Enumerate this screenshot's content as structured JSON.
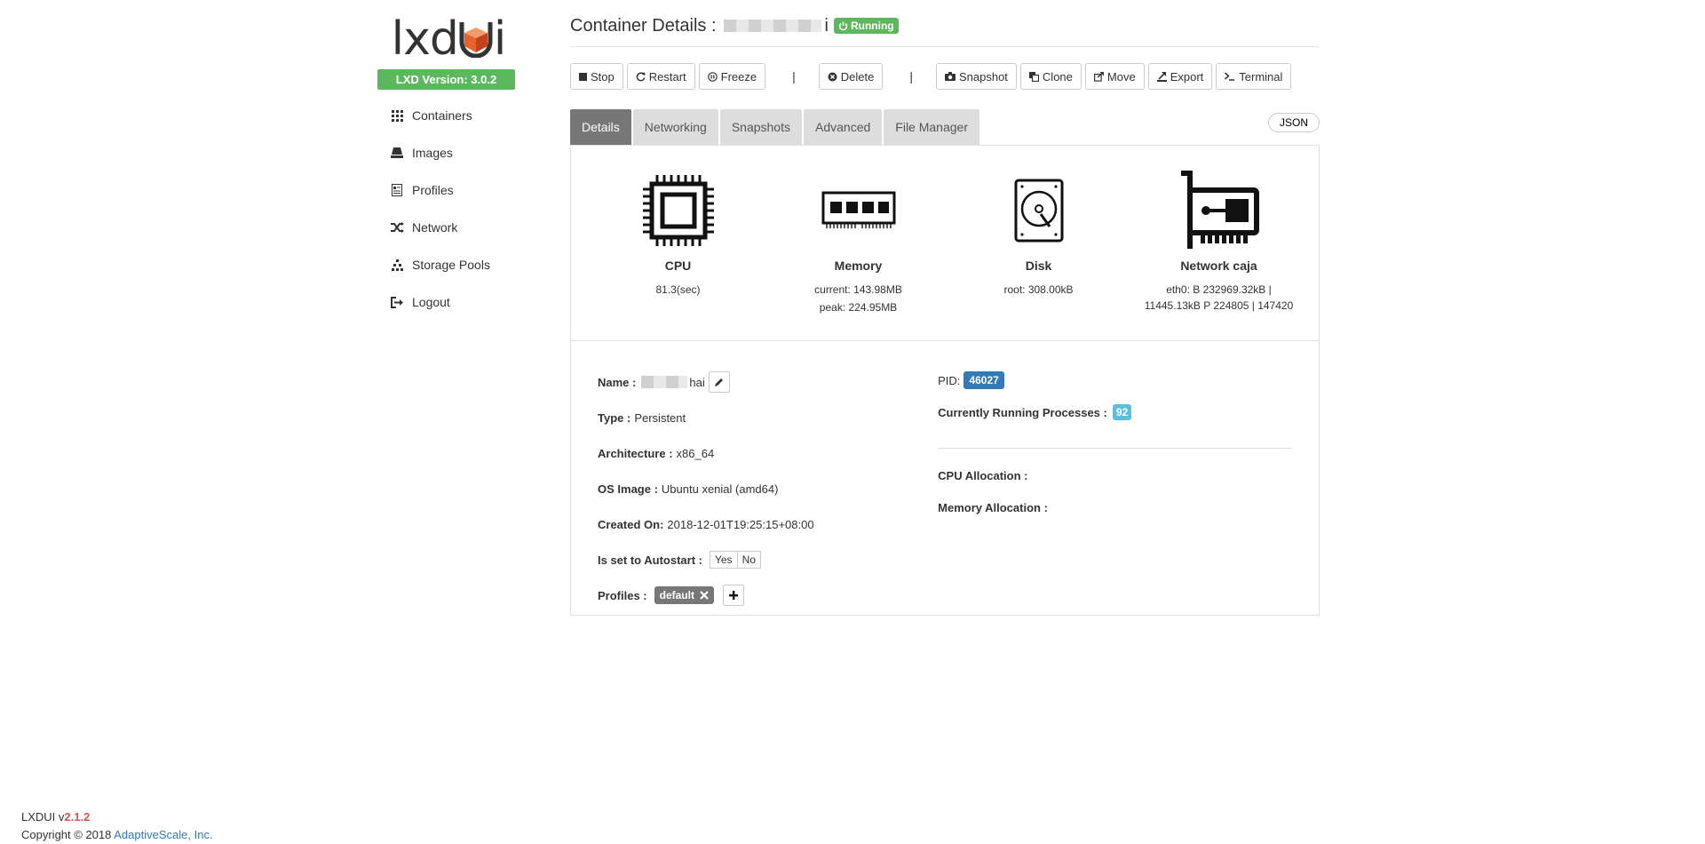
{
  "sidebar": {
    "logo_prefix": "lxd",
    "logo_suffix": "i",
    "lxd_version": "LXD Version: 3.0.2",
    "items": [
      {
        "label": "Containers",
        "icon": "grid-icon"
      },
      {
        "label": "Images",
        "icon": "images-icon"
      },
      {
        "label": "Profiles",
        "icon": "profiles-icon"
      },
      {
        "label": "Network",
        "icon": "network-shuffle-icon"
      },
      {
        "label": "Storage Pools",
        "icon": "storage-icon"
      },
      {
        "label": "Logout",
        "icon": "logout-icon"
      }
    ]
  },
  "header": {
    "title": "Container Details :",
    "name_tail": "i",
    "status": "Running"
  },
  "toolbar": {
    "stop": "Stop",
    "restart": "Restart",
    "freeze": "Freeze",
    "separator": "|",
    "delete": "Delete",
    "snapshot": "Snapshot",
    "clone": "Clone",
    "move": "Move",
    "export": "Export",
    "terminal": "Terminal"
  },
  "tabs": [
    {
      "label": "Details",
      "active": true
    },
    {
      "label": "Networking",
      "active": false
    },
    {
      "label": "Snapshots",
      "active": false
    },
    {
      "label": "Advanced",
      "active": false
    },
    {
      "label": "File Manager",
      "active": false
    }
  ],
  "json_button": "JSON",
  "resources": {
    "cpu": {
      "name": "CPU",
      "value": "81.3(sec)"
    },
    "memory": {
      "name": "Memory",
      "current": "current: 143.98MB",
      "peak": "peak: 224.95MB"
    },
    "disk": {
      "name": "Disk",
      "value": "root: 308.00kB"
    },
    "network": {
      "name": "Network caja",
      "value": "eth0: B 232969.32kB | 11445.13kB P 224805 | 147420"
    }
  },
  "details": {
    "name_label": "Name :",
    "name_tail": "hai",
    "type_label": "Type :",
    "type_value": "Persistent",
    "arch_label": "Architecture :",
    "arch_value": "x86_64",
    "os_label": "OS Image :",
    "os_value": "Ubuntu xenial (amd64)",
    "created_label": "Created On:",
    "created_value": "2018-12-01T19:25:15+08:00",
    "autostart_label": "Is set to Autostart :",
    "autostart_yes": "Yes",
    "autostart_no": "No",
    "profiles_label": "Profiles :",
    "profile_default": "default",
    "pid_label": "PID:",
    "pid_value": "46027",
    "procs_label": "Currently Running Processes :",
    "procs_value": "92",
    "cpu_alloc_label": "CPU Allocation :",
    "mem_alloc_label": "Memory Allocation :"
  },
  "footer": {
    "app": "LXDUI v",
    "version": "2.1.2",
    "copyright": "Copyright © 2018",
    "company": "AdaptiveScale, Inc."
  },
  "colors": {
    "green": "#5cb85c",
    "blue": "#337ab7",
    "info": "#5bc0de",
    "tab_active": "#777777",
    "logo_orange": "#e8612c"
  }
}
